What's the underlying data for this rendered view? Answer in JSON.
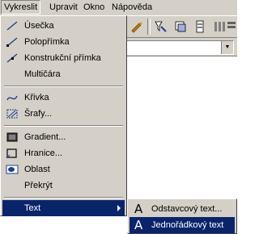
{
  "menubar": {
    "items": [
      {
        "label": "Vykreslit",
        "active": true
      },
      {
        "label": "Upravit"
      },
      {
        "label": "Okno"
      },
      {
        "label": "Nápověda"
      }
    ]
  },
  "toolbar": {
    "icons": [
      "pencil-icon",
      "filter-icon",
      "layers-icon",
      "stack-icon",
      "columns-icon",
      "bars-icon"
    ]
  },
  "combo": {
    "value": ""
  },
  "draw_menu": {
    "items": [
      {
        "label": "Úsečka",
        "icon": "line-icon"
      },
      {
        "label": "Polopřímka",
        "icon": "ray-icon"
      },
      {
        "label": "Konstrukční přímka",
        "icon": "construction-line-icon"
      },
      {
        "label": "Multičára",
        "icon": ""
      },
      {
        "label": "Křivka",
        "icon": "spline-icon"
      },
      {
        "label": "Šrafy...",
        "icon": "hatch-icon"
      },
      {
        "label": "Gradient...",
        "icon": "gradient-icon"
      },
      {
        "label": "Hranice...",
        "icon": "boundary-icon"
      },
      {
        "label": "Oblast",
        "icon": "region-icon"
      },
      {
        "label": "Překrýt",
        "icon": ""
      },
      {
        "label": "Text",
        "icon": "",
        "highlighted": true,
        "submenu": true
      }
    ]
  },
  "text_submenu": {
    "items": [
      {
        "label": "Odstavcový text...",
        "icon_glyph": "A"
      },
      {
        "label": "Jednořádkový text",
        "icon_glyph": "A",
        "highlighted": true
      }
    ]
  },
  "colors": {
    "menu_face": "#d4d0c8",
    "highlight": "#0a246a",
    "line_icon": "#1f3f8f"
  }
}
